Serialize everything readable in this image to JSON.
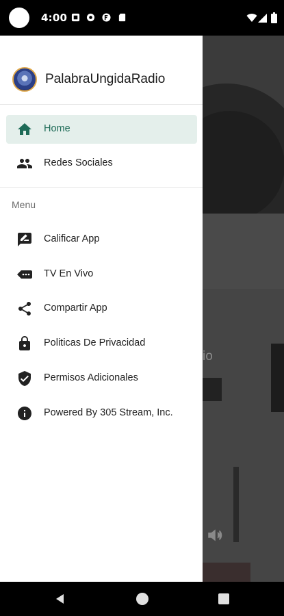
{
  "status_bar": {
    "time": "4:00",
    "notification_icons": [
      "notification-icon",
      "settings-icon",
      "f-icon",
      "sd-card-icon"
    ],
    "system_icons": [
      "wifi-icon",
      "signal-icon",
      "battery-icon"
    ]
  },
  "drawer": {
    "app_title": "PalabraUngidaRadio",
    "primary_items": [
      {
        "label": "Home",
        "icon": "home-icon",
        "active": true
      },
      {
        "label": "Redes Sociales",
        "icon": "people-icon",
        "active": false
      }
    ],
    "section_title": "Menu",
    "menu_items": [
      {
        "label": "Calificar App",
        "icon": "rate-review-icon"
      },
      {
        "label": "TV En Vivo",
        "icon": "live-tv-icon"
      },
      {
        "label": "Compartir App",
        "icon": "share-icon"
      },
      {
        "label": "Politicas De Privacidad",
        "icon": "lock-icon"
      },
      {
        "label": "Permisos Adicionales",
        "icon": "verified-shield-icon"
      },
      {
        "label": "Powered By 305 Stream, Inc.",
        "icon": "info-icon"
      }
    ]
  },
  "background": {
    "partial_text": "io"
  },
  "colors": {
    "accent": "#1e6b57",
    "active_bg": "#e4efeb"
  }
}
